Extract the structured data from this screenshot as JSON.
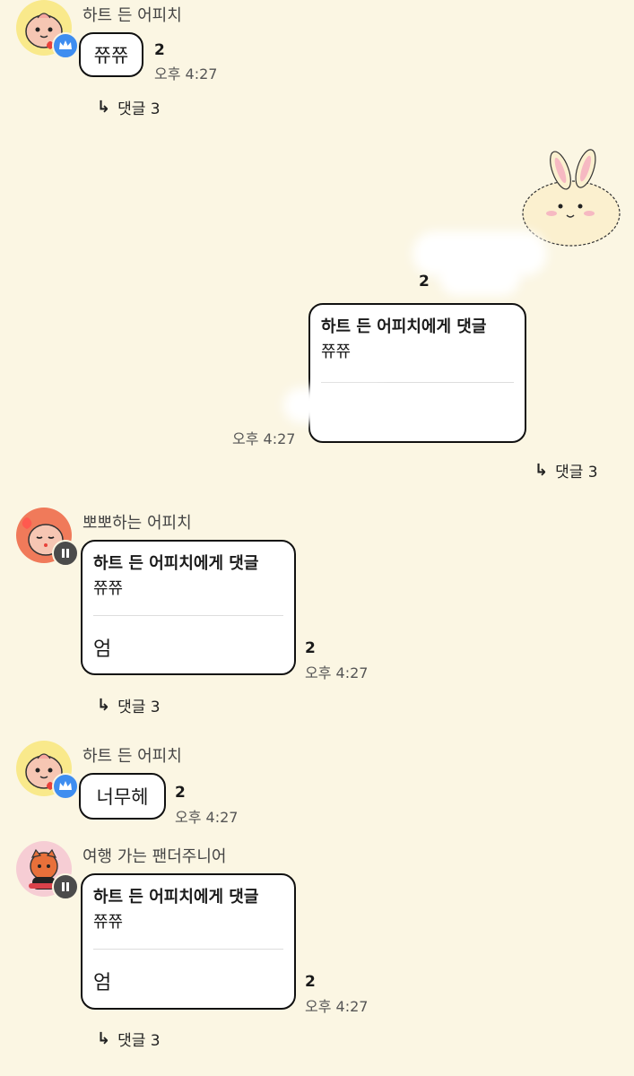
{
  "messages": [
    {
      "sender": "하트 든 어피치",
      "text": "쮸쮸",
      "unread": "2",
      "time": "오후 4:27",
      "comments": "댓글 3"
    },
    {
      "reply_to": "하트 든 어피치에게 댓글",
      "quote": "쮸쮸",
      "unread": "2",
      "time": "오후 4:27",
      "comments": "댓글 3"
    },
    {
      "sender": "뽀뽀하는 어피치",
      "reply_to": "하트 든 어피치에게 댓글",
      "quote": "쮸쮸",
      "text": "엄",
      "unread": "2",
      "time": "오후 4:27",
      "comments": "댓글 3"
    },
    {
      "sender": "하트 든 어피치",
      "text": "너무헤",
      "unread": "2",
      "time": "오후 4:27"
    },
    {
      "sender": "여행 가는 팬더주니어",
      "reply_to": "하트 든 어피치에게 댓글",
      "quote": "쮸쮸",
      "text": "엄",
      "unread": "2",
      "time": "오후 4:27",
      "comments": "댓글 3"
    }
  ],
  "colors": {
    "background": "#fbf6e3",
    "crown_badge": "#3e8df0",
    "dark_badge": "#4b4b4b"
  },
  "icons": [
    "crown-icon",
    "pause-icon",
    "reply-arrow-icon"
  ]
}
